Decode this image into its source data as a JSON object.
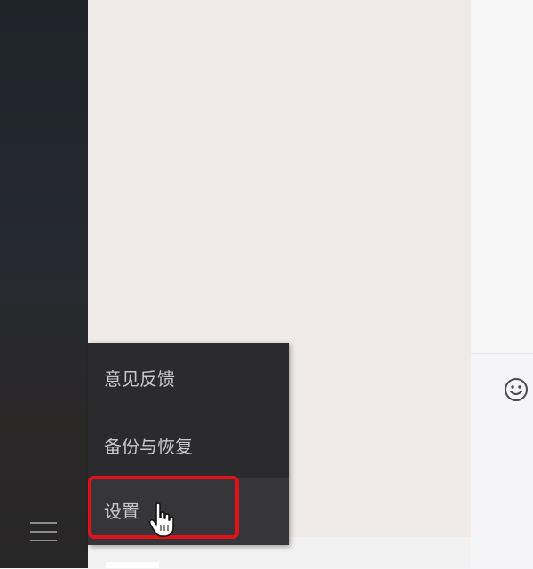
{
  "sidebar": {
    "menu_icon": "hamburger-menu-icon"
  },
  "popup_menu": {
    "items": [
      {
        "label": "意见反馈"
      },
      {
        "label": "备份与恢复"
      },
      {
        "label": "设置",
        "highlighted": true
      }
    ]
  },
  "input_area": {
    "emoji_icon": "emoji-smile-icon"
  },
  "annotation": {
    "highlight_color": "#e3121a",
    "cursor_icon": "hand-pointer-icon"
  },
  "colors": {
    "sidebar": "#23272c",
    "chat_background": "#f0ebe8",
    "menu_background": "#2b2a2d",
    "menu_text": "#c9c9cc"
  }
}
